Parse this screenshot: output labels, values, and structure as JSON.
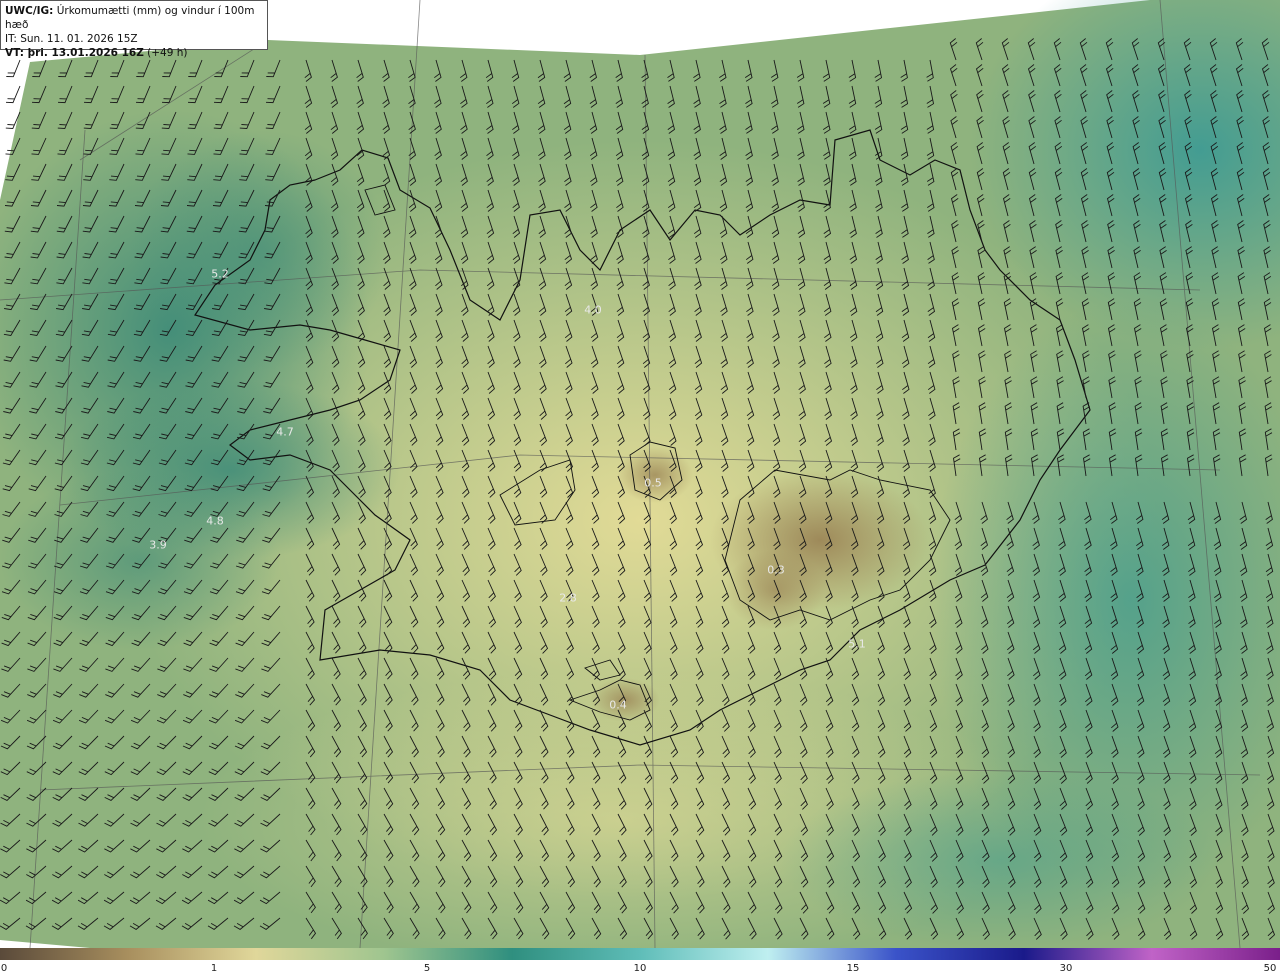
{
  "header": {
    "line1_bold": "UWC/IG:",
    "line1_rest": " Úrkomumætti (mm) og vindur í 100m hæð",
    "line2": "IT: Sun. 11. 01. 2026 15Z",
    "line3_bold": "VT: þri. 13.01.2026 16Z",
    "line3_rest": " (+49 h)"
  },
  "value_labels": [
    {
      "id": "v1",
      "text": "5.2"
    },
    {
      "id": "v2",
      "text": "4.0"
    },
    {
      "id": "v3",
      "text": "4.7"
    },
    {
      "id": "v4",
      "text": "4.8"
    },
    {
      "id": "v5",
      "text": "3.9"
    },
    {
      "id": "v6",
      "text": "0.5"
    },
    {
      "id": "v7",
      "text": "0.3"
    },
    {
      "id": "v8",
      "text": "2.8"
    },
    {
      "id": "v9",
      "text": "5.1"
    },
    {
      "id": "v10",
      "text": "0.4"
    }
  ],
  "colorbar": {
    "ticks": [
      "0",
      "1",
      "5",
      "10",
      "15",
      "30",
      "50"
    ],
    "colors": [
      "#5a4a3a",
      "#a88f5e",
      "#e0d79a",
      "#9fc58f",
      "#2f8f7f",
      "#5fbdb8",
      "#bfeff0",
      "#3a53c9",
      "#1a1a8a",
      "#c063c7",
      "#7a1f8a"
    ]
  },
  "colors": {
    "ocean_green": "#5f9f82",
    "land_yellow": "#d9d58f",
    "highland_brown": "#a48f5d",
    "deep_teal": "#2e7f74"
  }
}
